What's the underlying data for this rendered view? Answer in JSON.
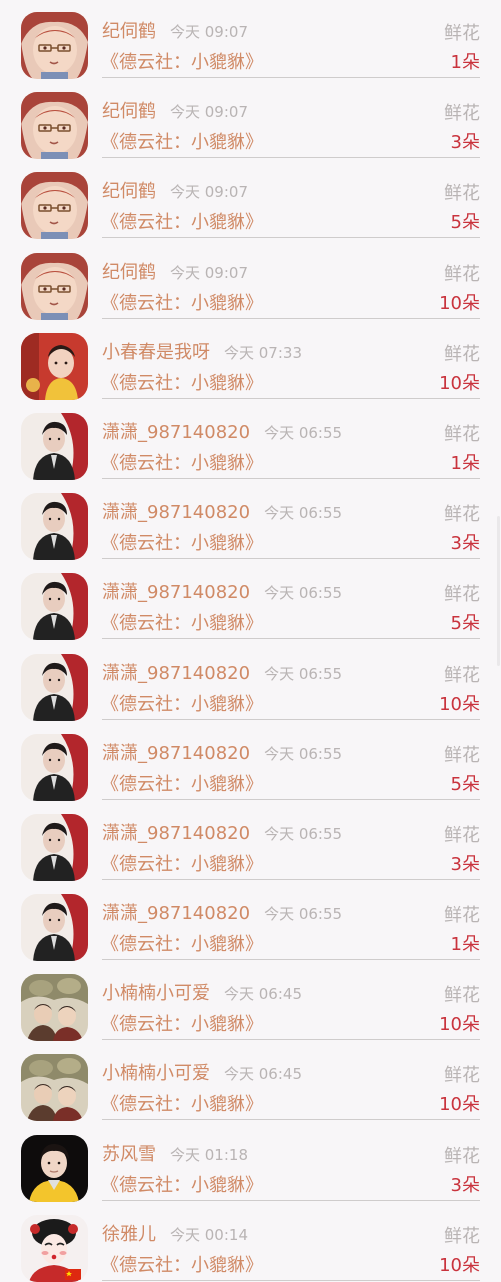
{
  "colors": {
    "background": "#f8f6f8",
    "name": "#d08a66",
    "meta": "#b9b4b4",
    "count": "#c9333d",
    "divider": "#cfcccc"
  },
  "gifts": [
    {
      "avatar": "anime-girl-avatar",
      "name": "纪伺鹤",
      "time": "今天 09:07",
      "label": "鲜花",
      "title": "《德云社：小貔貅》",
      "count": "1朵"
    },
    {
      "avatar": "anime-girl-avatar",
      "name": "纪伺鹤",
      "time": "今天 09:07",
      "label": "鲜花",
      "title": "《德云社：小貔貅》",
      "count": "3朵"
    },
    {
      "avatar": "anime-girl-avatar",
      "name": "纪伺鹤",
      "time": "今天 09:07",
      "label": "鲜花",
      "title": "《德云社：小貔貅》",
      "count": "5朵"
    },
    {
      "avatar": "anime-girl-avatar",
      "name": "纪伺鹤",
      "time": "今天 09:07",
      "label": "鲜花",
      "title": "《德云社：小貔貅》",
      "count": "10朵"
    },
    {
      "avatar": "red-outfit-avatar",
      "name": "小春春是我呀",
      "time": "今天 07:33",
      "label": "鲜花",
      "title": "《德云社：小貔貅》",
      "count": "10朵"
    },
    {
      "avatar": "dark-suit-avatar",
      "name": "潇潇_987140820",
      "time": "今天 06:55",
      "label": "鲜花",
      "title": "《德云社：小貔貅》",
      "count": "1朵"
    },
    {
      "avatar": "dark-suit-avatar",
      "name": "潇潇_987140820",
      "time": "今天 06:55",
      "label": "鲜花",
      "title": "《德云社：小貔貅》",
      "count": "3朵"
    },
    {
      "avatar": "dark-suit-avatar",
      "name": "潇潇_987140820",
      "time": "今天 06:55",
      "label": "鲜花",
      "title": "《德云社：小貔貅》",
      "count": "5朵"
    },
    {
      "avatar": "dark-suit-avatar",
      "name": "潇潇_987140820",
      "time": "今天 06:55",
      "label": "鲜花",
      "title": "《德云社：小貔貅》",
      "count": "10朵"
    },
    {
      "avatar": "dark-suit-avatar",
      "name": "潇潇_987140820",
      "time": "今天 06:55",
      "label": "鲜花",
      "title": "《德云社：小貔貅》",
      "count": "5朵"
    },
    {
      "avatar": "dark-suit-avatar",
      "name": "潇潇_987140820",
      "time": "今天 06:55",
      "label": "鲜花",
      "title": "《德云社：小貔貅》",
      "count": "3朵"
    },
    {
      "avatar": "dark-suit-avatar",
      "name": "潇潇_987140820",
      "time": "今天 06:55",
      "label": "鲜花",
      "title": "《德云社：小貔貅》",
      "count": "1朵"
    },
    {
      "avatar": "group-photo-avatar",
      "name": "小楠楠小可爱",
      "time": "今天 06:45",
      "label": "鲜花",
      "title": "《德云社：小貔貅》",
      "count": "10朵"
    },
    {
      "avatar": "group-photo-avatar",
      "name": "小楠楠小可爱",
      "time": "今天 06:45",
      "label": "鲜花",
      "title": "《德云社：小貔貅》",
      "count": "10朵"
    },
    {
      "avatar": "yellow-shirt-avatar",
      "name": "苏风雪",
      "time": "今天 01:18",
      "label": "鲜花",
      "title": "《德云社：小貔貅》",
      "count": "3朵"
    },
    {
      "avatar": "opera-face-avatar",
      "name": "徐雅儿",
      "time": "今天 00:14",
      "label": "鲜花",
      "title": "《德云社：小貔貅》",
      "count": "10朵"
    }
  ]
}
